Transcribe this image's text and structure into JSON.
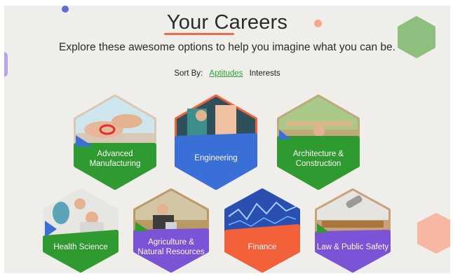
{
  "page": {
    "title": "Your Careers",
    "subtitle": "Explore these awesome options to help you imagine what you can be."
  },
  "sort": {
    "label": "Sort By:",
    "options": [
      "Aptitudes",
      "Interests"
    ],
    "active": "Aptitudes"
  },
  "careers": [
    {
      "label_line1": "Advanced",
      "label_line2": "Manufacturing",
      "color": "#2f9a2f",
      "image_icon": "hands-cable-icon"
    },
    {
      "label_line1": "Engineering",
      "label_line2": "",
      "color": "#3b6fd8",
      "image_icon": "engineers-icon"
    },
    {
      "label_line1": "Architecture &",
      "label_line2": "Construction",
      "color": "#2f9a2f",
      "image_icon": "construction-site-icon"
    },
    {
      "label_line1": "Health Science",
      "label_line2": "",
      "color": "#2f9a2f",
      "image_icon": "lab-workers-icon"
    },
    {
      "label_line1": "Agriculture &",
      "label_line2": "Natural Resources",
      "color": "#7b53d6",
      "image_icon": "farmer-icon"
    },
    {
      "label_line1": "Finance",
      "label_line2": "",
      "color": "#f2613a",
      "image_icon": "stock-chart-icon"
    },
    {
      "label_line1": "Law & Public Safety",
      "label_line2": "",
      "color": "#7b53d6",
      "image_icon": "courtroom-icon"
    }
  ],
  "colors": {
    "green": "#2f9a2f",
    "blue": "#3b6fd8",
    "purple": "#7b53d6",
    "orange": "#f2613a",
    "background": "#efeeea"
  }
}
